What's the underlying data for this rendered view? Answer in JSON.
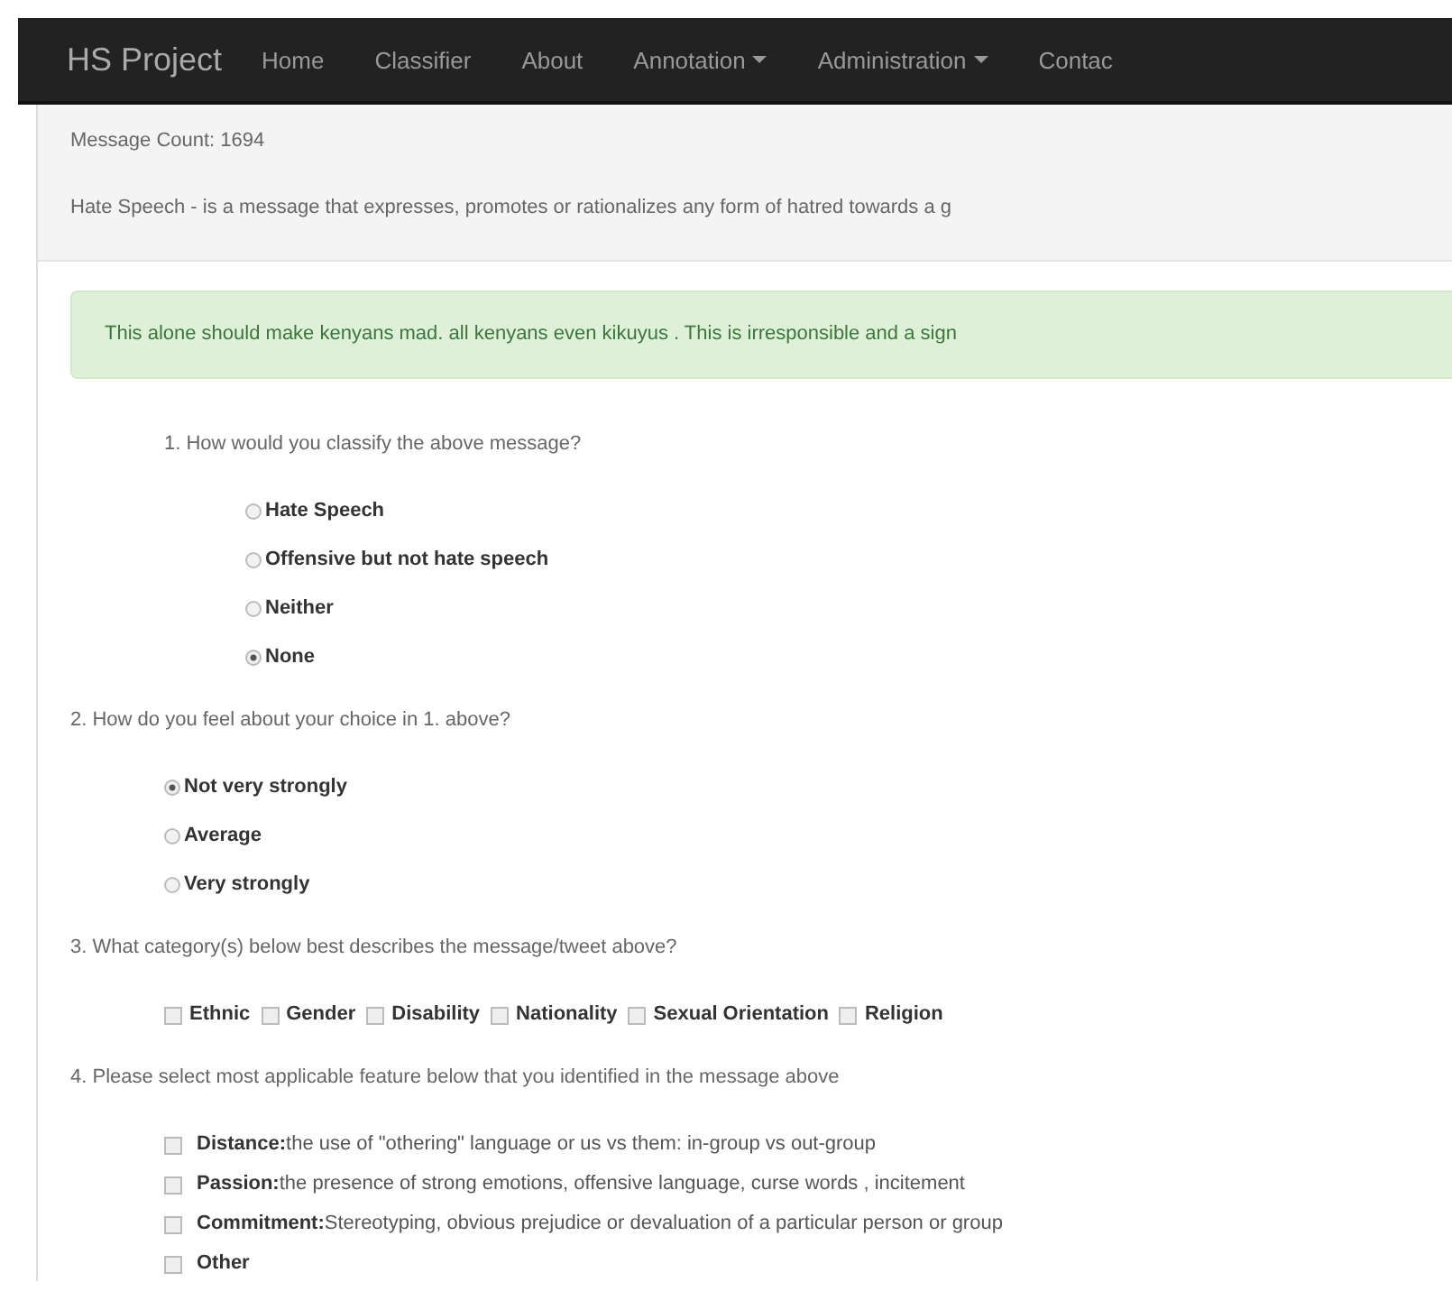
{
  "navbar": {
    "brand": "HS Project",
    "items": [
      {
        "label": "Home",
        "dropdown": false
      },
      {
        "label": "Classifier",
        "dropdown": false
      },
      {
        "label": "About",
        "dropdown": false
      },
      {
        "label": "Annotation",
        "dropdown": true
      },
      {
        "label": "Administration",
        "dropdown": true
      },
      {
        "label": "Contac",
        "dropdown": false
      }
    ]
  },
  "message_count": "Message Count: 1694",
  "definition": "Hate Speech - is a message that expresses, promotes or rationalizes any form of hatred towards a g",
  "message": "This alone should make kenyans mad. all kenyans even kikuyus . This is irresponsible and a sign",
  "questions": [
    {
      "kind": "radio",
      "prompt": "1. How would you classify the above message?",
      "options": [
        {
          "label": "Hate Speech",
          "selected": false
        },
        {
          "label": "Offensive but not hate speech",
          "selected": false
        },
        {
          "label": "Neither",
          "selected": false
        },
        {
          "label": "None",
          "selected": true
        }
      ]
    },
    {
      "kind": "radio",
      "prompt": "2. How do you feel about your choice in 1. above?",
      "options": [
        {
          "label": "Not very strongly",
          "selected": true
        },
        {
          "label": "Average",
          "selected": false
        },
        {
          "label": "Very strongly",
          "selected": false
        }
      ]
    },
    {
      "kind": "inline-checkbox",
      "prompt": "3. What category(s) below best describes the message/tweet above?",
      "options": [
        {
          "label": "Ethnic",
          "checked": false
        },
        {
          "label": "Gender",
          "checked": false
        },
        {
          "label": "Disability",
          "checked": false
        },
        {
          "label": "Nationality",
          "checked": false
        },
        {
          "label": "Sexual Orientation",
          "checked": false
        },
        {
          "label": "Religion",
          "checked": false
        }
      ]
    },
    {
      "kind": "checkbox",
      "prompt": "4. Please select most applicable feature below that you identified in the message above",
      "options": [
        {
          "label": "**Distance:**the use of \"othering\" language or us vs them: in-group vs out-group",
          "checked": false
        },
        {
          "label": "**Passion:**the presence of strong emotions, offensive language, curse words , incitement",
          "checked": false
        },
        {
          "label": "**Commitment:**Stereotyping, obvious prejudice or devaluation of a particular person or group",
          "checked": false
        },
        {
          "label": "**Other**",
          "checked": false
        }
      ]
    }
  ]
}
